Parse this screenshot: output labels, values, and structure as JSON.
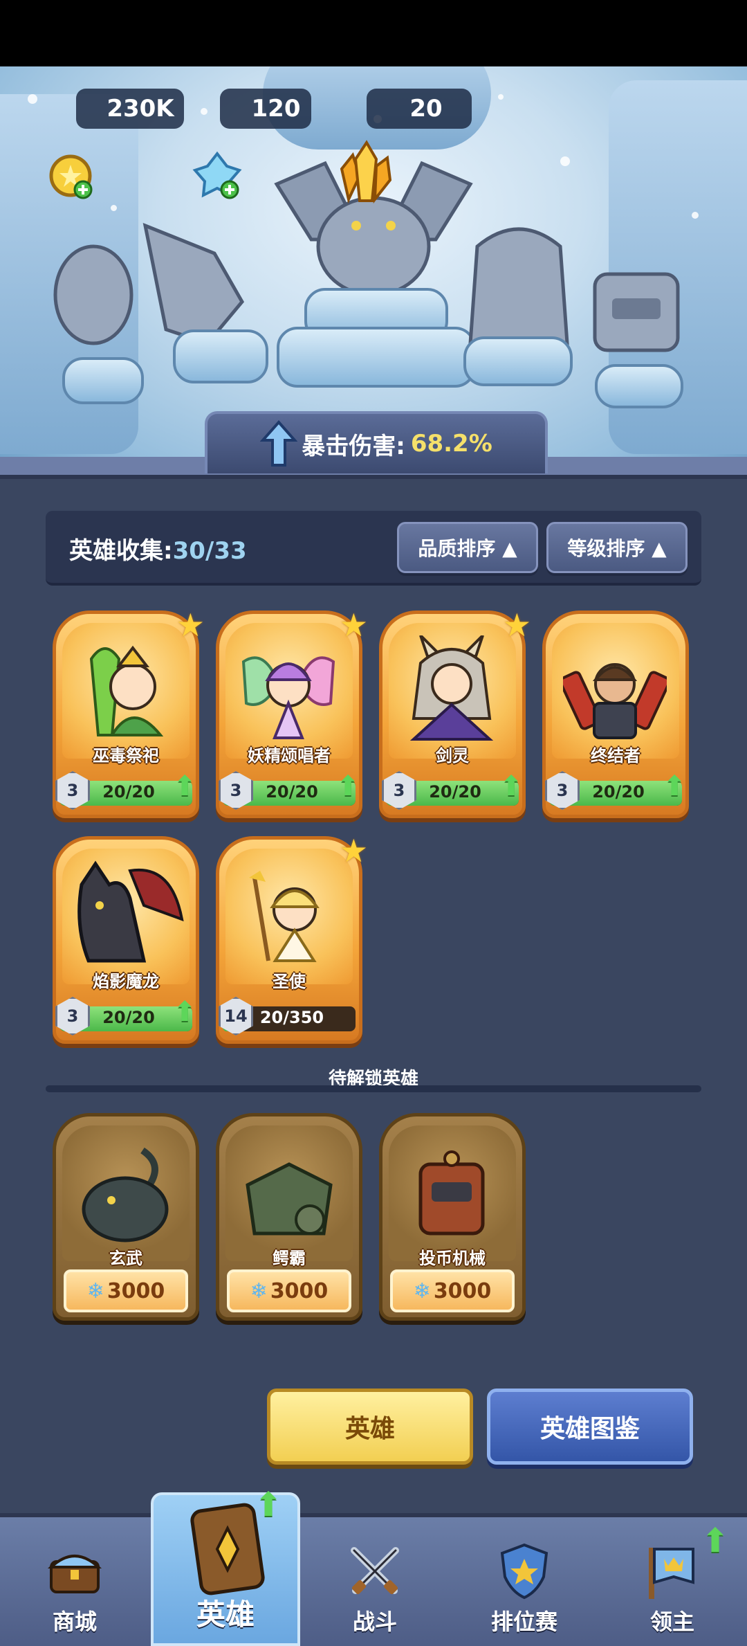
{
  "resources": {
    "gold": "230K",
    "gems": "120",
    "crystals": "20"
  },
  "crit_banner": {
    "label": "暴击伤害:",
    "value": "68.2%"
  },
  "collection": {
    "label": "英雄收集:",
    "count": "30/33",
    "sort_quality": "品质排序 ▲",
    "sort_level": "等级排序 ▲"
  },
  "heroes": [
    {
      "name": "巫毒祭祀",
      "level": "3",
      "progress": "20/20",
      "fill": 1.0,
      "star": true
    },
    {
      "name": "妖精颂唱者",
      "level": "3",
      "progress": "20/20",
      "fill": 1.0,
      "star": true
    },
    {
      "name": "剑灵",
      "level": "3",
      "progress": "20/20",
      "fill": 1.0,
      "star": true
    },
    {
      "name": "终结者",
      "level": "3",
      "progress": "20/20",
      "fill": 1.0,
      "star": false
    },
    {
      "name": "焰影魔龙",
      "level": "3",
      "progress": "20/20",
      "fill": 1.0,
      "star": false
    },
    {
      "name": "圣使",
      "level": "14",
      "progress": "20/350",
      "fill": 0.06,
      "star": true
    }
  ],
  "locked_section": {
    "title": "待解锁英雄"
  },
  "locked_heroes": [
    {
      "name": "玄武",
      "price": "3000"
    },
    {
      "name": "鳄霸",
      "price": "3000"
    },
    {
      "name": "投币机械",
      "price": "3000"
    }
  ],
  "buttons": {
    "heroes": "英雄",
    "codex": "英雄图鉴"
  },
  "nav": [
    {
      "label": "商城"
    },
    {
      "label": "英雄"
    },
    {
      "label": "战斗"
    },
    {
      "label": "排位赛"
    },
    {
      "label": "领主"
    }
  ],
  "colors": {
    "accent_gold": "#f5e06a",
    "card_orange": "#f4a53a",
    "progress_green": "#4bb84a",
    "background": "#3a4660"
  }
}
